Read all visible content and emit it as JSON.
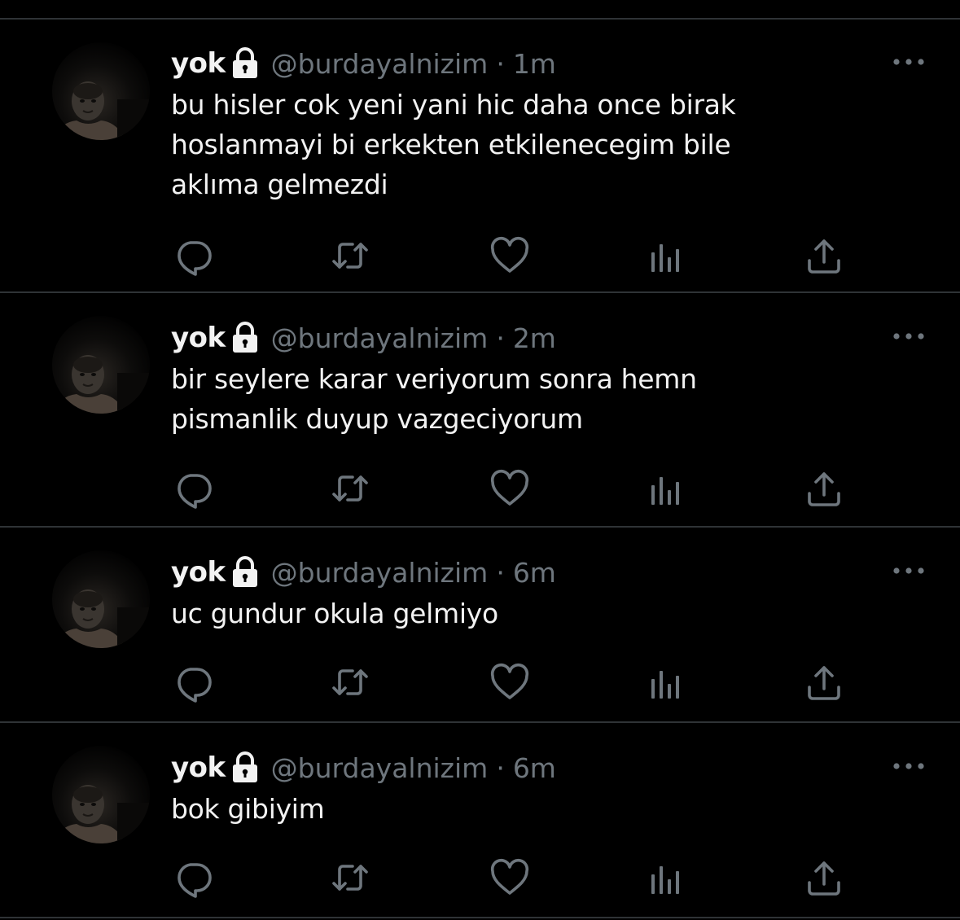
{
  "tweets": [
    {
      "display_name": "yok",
      "handle": "@burdayalnizim",
      "separator": "·",
      "time": "1m",
      "text": "bu hisler cok yeni yani hic daha once birak\nhoslanmayi bi erkekten etkilenecegim bile\naklıma gelmezdi"
    },
    {
      "display_name": "yok",
      "handle": "@burdayalnizim",
      "separator": "·",
      "time": "2m",
      "text": "bir seylere karar veriyorum sonra hemn\npismanlik duyup vazgeciyorum"
    },
    {
      "display_name": "yok",
      "handle": "@burdayalnizim",
      "separator": "·",
      "time": "6m",
      "text": "uc gundur okula gelmiyo"
    },
    {
      "display_name": "yok",
      "handle": "@burdayalnizim",
      "separator": "·",
      "time": "6m",
      "text": "bok gibiyim"
    }
  ],
  "icons": {
    "lock": "lock-icon",
    "more": "more-options-icon",
    "reply": "reply-icon",
    "retweet": "retweet-icon",
    "like": "like-icon",
    "analytics": "analytics-icon",
    "share": "share-icon"
  },
  "colors": {
    "background": "#000000",
    "text_primary": "#f2f2f2",
    "text_secondary": "#6e767d",
    "divider": "#2f3336",
    "icon": "#6e767d"
  }
}
